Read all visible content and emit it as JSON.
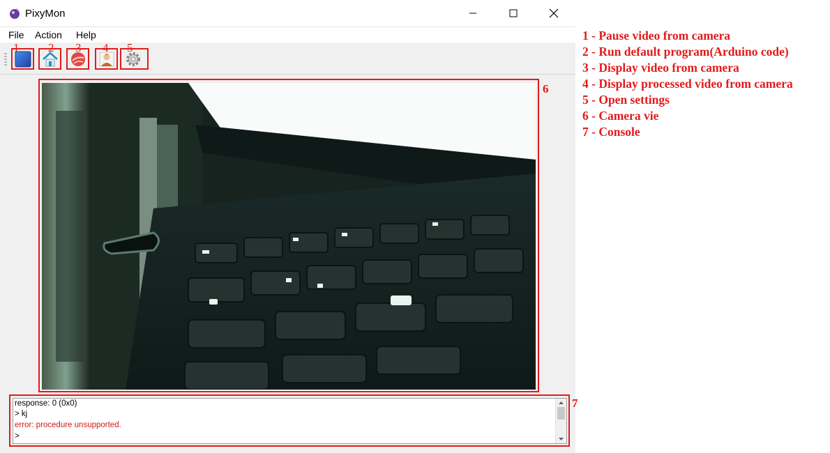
{
  "window": {
    "title": "PixyMon"
  },
  "menu": [
    "File",
    "Action",
    "Help"
  ],
  "toolbar": [
    {
      "number": "1",
      "icon": "stop-video-icon"
    },
    {
      "number": "2",
      "icon": "home-icon"
    },
    {
      "number": "3",
      "icon": "raw-video-icon"
    },
    {
      "number": "4",
      "icon": "processed-video-icon"
    },
    {
      "number": "5",
      "icon": "gear-icon"
    }
  ],
  "annotations": {
    "camera": "6",
    "console": "7"
  },
  "console_lines": [
    {
      "text": "response: 0 (0x0)",
      "color": "#000000"
    },
    {
      "text": "> kj",
      "color": "#000000"
    },
    {
      "text": "error: procedure unsupported.",
      "color": "#d11a1a"
    },
    {
      "text": ">",
      "color": "#000000"
    }
  ],
  "legend": [
    "1 - Pause video from camera",
    "2 - Run default program(Arduino code)",
    "3 - Display video from camera",
    "4 - Display processed video from camera",
    "5 - Open settings",
    "6 - Camera vie",
    "7 - Console"
  ],
  "colors": {
    "annotation": "#e21b1b",
    "error_text": "#d11a1a"
  }
}
